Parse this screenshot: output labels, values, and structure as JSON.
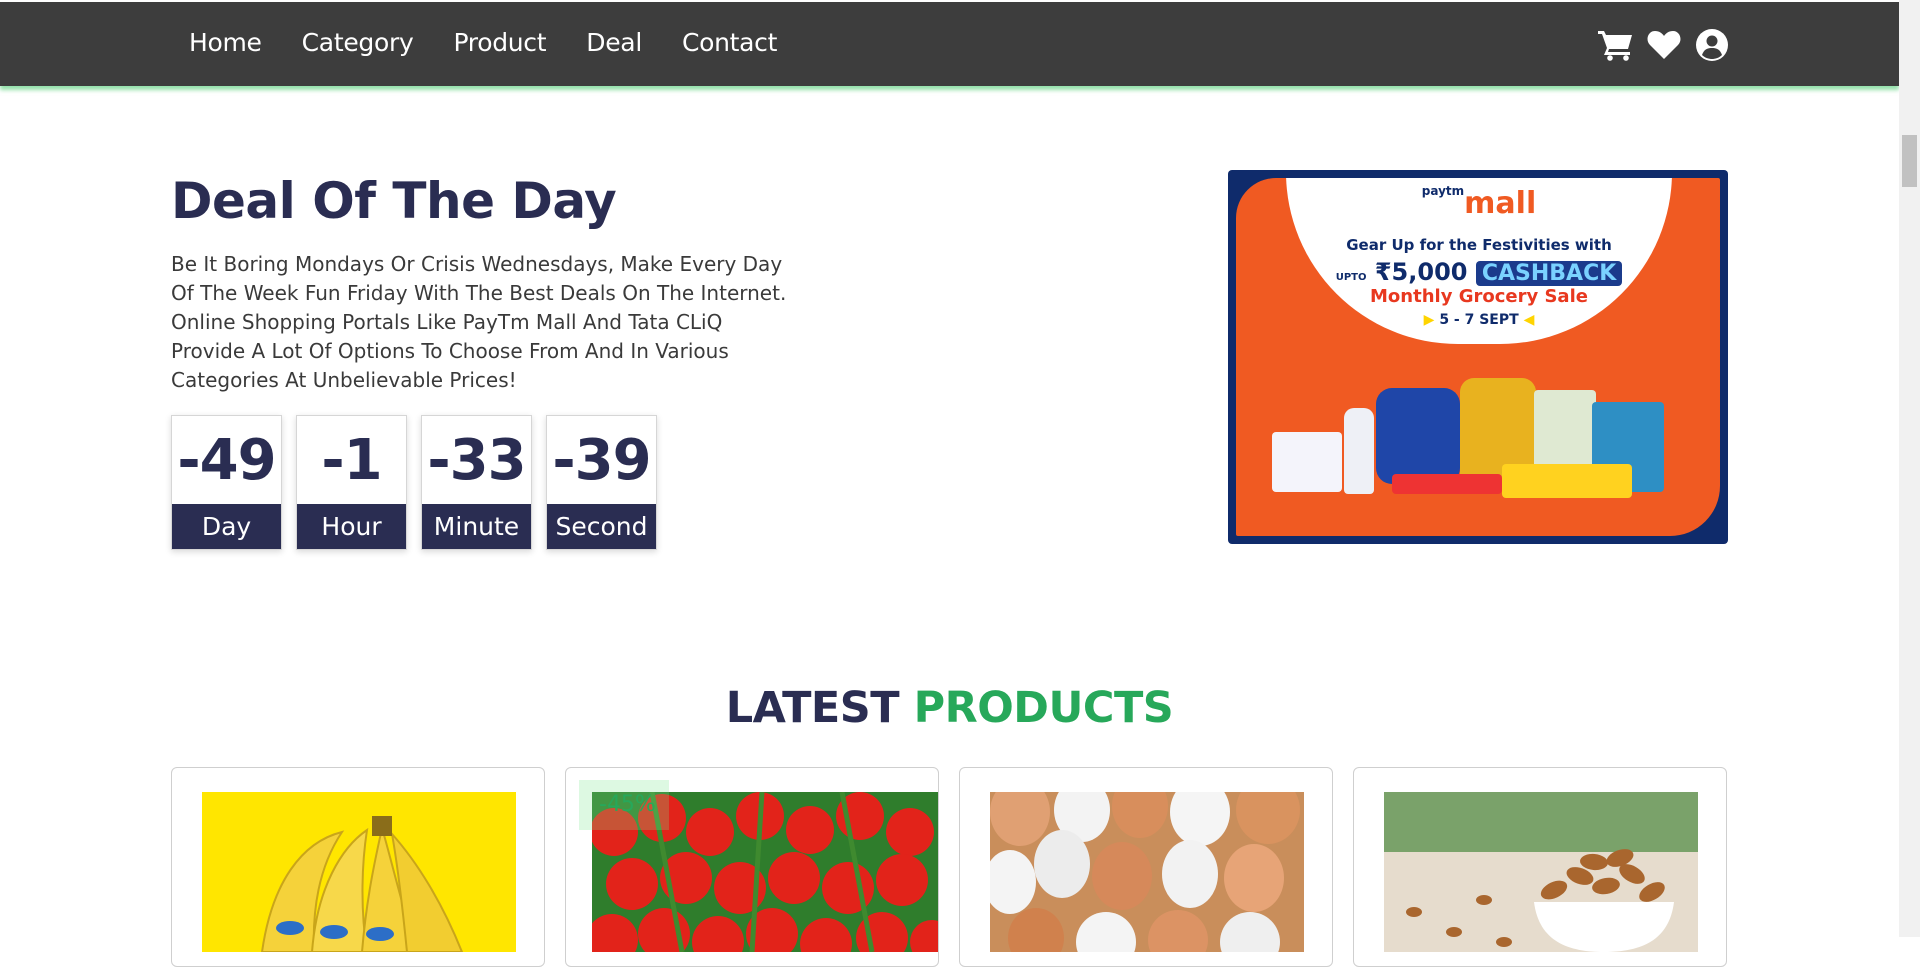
{
  "nav": {
    "links": [
      "Home",
      "Category",
      "Product",
      "Deal",
      "Contact"
    ],
    "icons": [
      "cart-icon",
      "heart-icon",
      "user-icon"
    ]
  },
  "deal": {
    "title": "Deal Of The Day",
    "description": "Be It Boring Mondays Or Crisis Wednesdays, Make Every Day Of The Week Fun Friday With The Best Deals On The Internet. Online Shopping Portals Like PayTm Mall And Tata CLiQ Provide A Lot Of Options To Choose From And In Various Categories At Unbelievable Prices!",
    "countdown": [
      {
        "value": "-49",
        "label": "Day"
      },
      {
        "value": "-1",
        "label": "Hour"
      },
      {
        "value": "-33",
        "label": "Minute"
      },
      {
        "value": "-39",
        "label": "Second"
      }
    ]
  },
  "banner": {
    "brand_small": "paytm",
    "brand": "mall",
    "line1": "Gear Up for the Festivities with",
    "upto": "UPTO",
    "amount": "₹5,000",
    "cashback": "CASHBACK",
    "line3": "Monthly Grocery Sale",
    "dates": "5 - 7 SEPT"
  },
  "latest": {
    "title_part1": "LATEST",
    "title_part2": "PRODUCTS",
    "cards": [
      {
        "image": "bananas"
      },
      {
        "image": "tomatoes",
        "badge": "-45%"
      },
      {
        "image": "eggs"
      },
      {
        "image": "almonds"
      }
    ]
  },
  "colors": {
    "navbar": "#3d3d3d",
    "accent": "#27a85a",
    "navy": "#2a2d52"
  }
}
